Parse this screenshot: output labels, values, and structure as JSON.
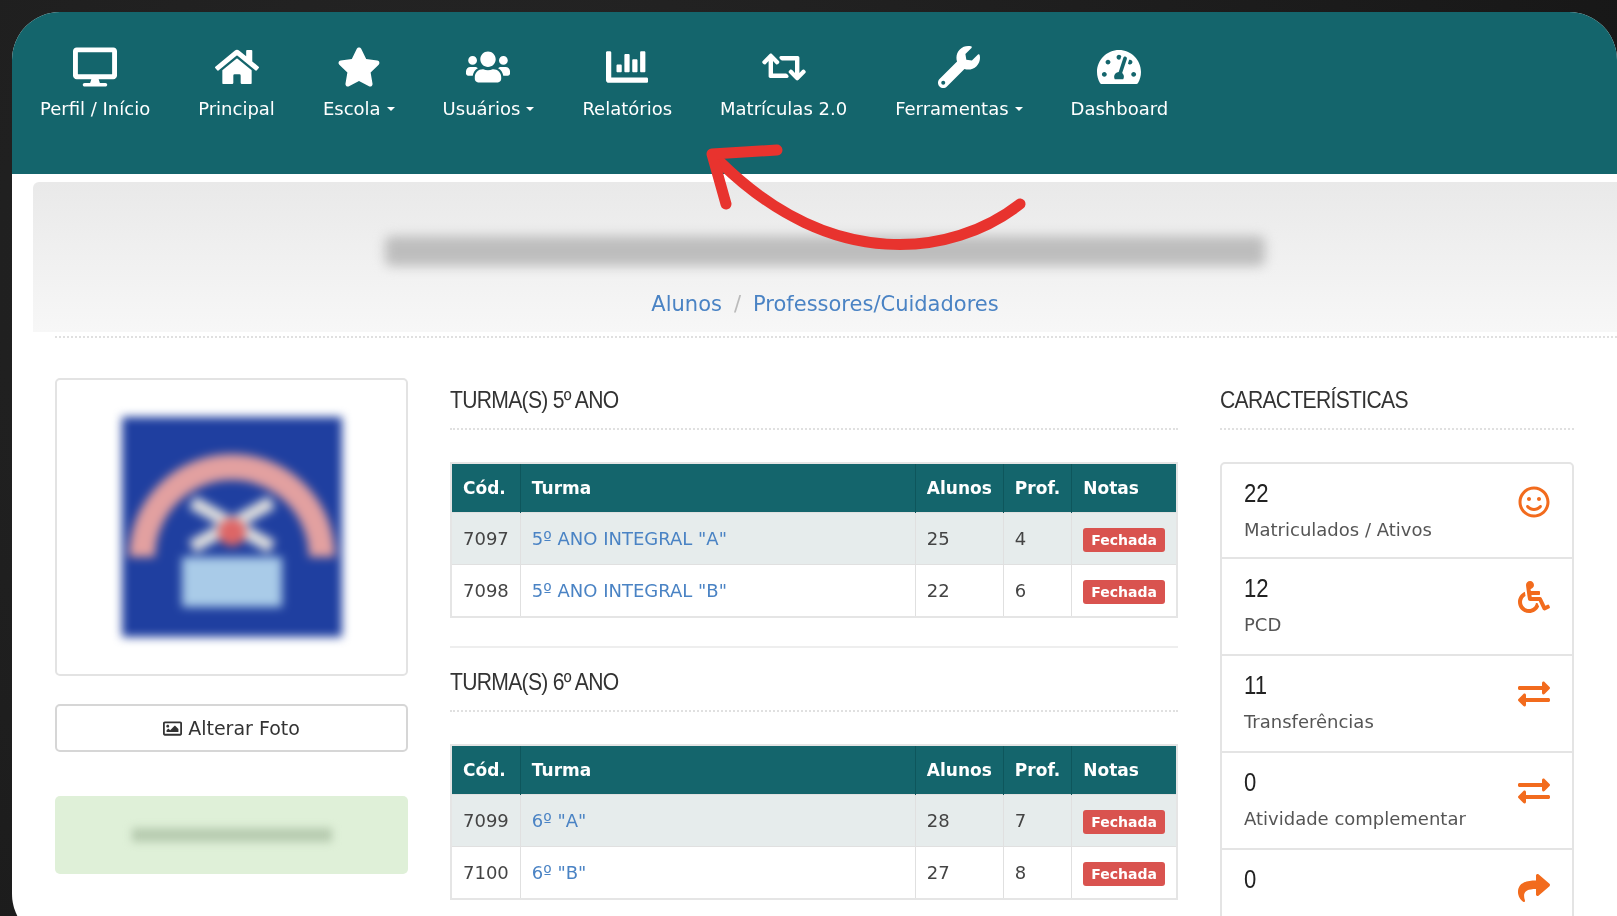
{
  "nav": [
    {
      "label": "Perfil / Início",
      "dropdown": false
    },
    {
      "label": "Principal",
      "dropdown": false
    },
    {
      "label": "Escola",
      "dropdown": true
    },
    {
      "label": "Usuários",
      "dropdown": true
    },
    {
      "label": "Relatórios",
      "dropdown": false
    },
    {
      "label": "Matrículas 2.0",
      "dropdown": false
    },
    {
      "label": "Ferramentas",
      "dropdown": true
    },
    {
      "label": "Dashboard",
      "dropdown": false
    }
  ],
  "breadcrumb": {
    "separator": "/",
    "items": [
      "Alunos",
      "Professores/Cuidadores"
    ]
  },
  "photo": {
    "kind": "picture",
    "button": "Alterar Foto"
  },
  "classes": [
    {
      "title": "TURMA(S) 5º ANO",
      "columns": [
        "Cód.",
        "Turma",
        "Alunos",
        "Prof.",
        "Notas"
      ],
      "rows": [
        {
          "code": "7097",
          "name": "5º ANO INTEGRAL \"A\"",
          "students": "25",
          "teachers": "4",
          "status": "Fechada"
        },
        {
          "code": "7098",
          "name": "5º ANO INTEGRAL \"B\"",
          "students": "22",
          "teachers": "6",
          "status": "Fechada"
        }
      ]
    },
    {
      "title": "TURMA(S) 6º ANO",
      "columns": [
        "Cód.",
        "Turma",
        "Alunos",
        "Prof.",
        "Notas"
      ],
      "rows": [
        {
          "code": "7099",
          "name": "6º \"A\"",
          "students": "28",
          "teachers": "7",
          "status": "Fechada"
        },
        {
          "code": "7100",
          "name": "6º \"B\"",
          "students": "27",
          "teachers": "8",
          "status": "Fechada"
        }
      ]
    }
  ],
  "characteristics": {
    "title": "CARACTERÍSTICAS",
    "items": [
      {
        "value": "22",
        "label": "Matriculados / Ativos"
      },
      {
        "value": "12",
        "label": "PCD"
      },
      {
        "value": "11",
        "label": "Transferências"
      },
      {
        "value": "0",
        "label": "Atividade complementar"
      },
      {
        "value": "0"
      }
    ]
  }
}
